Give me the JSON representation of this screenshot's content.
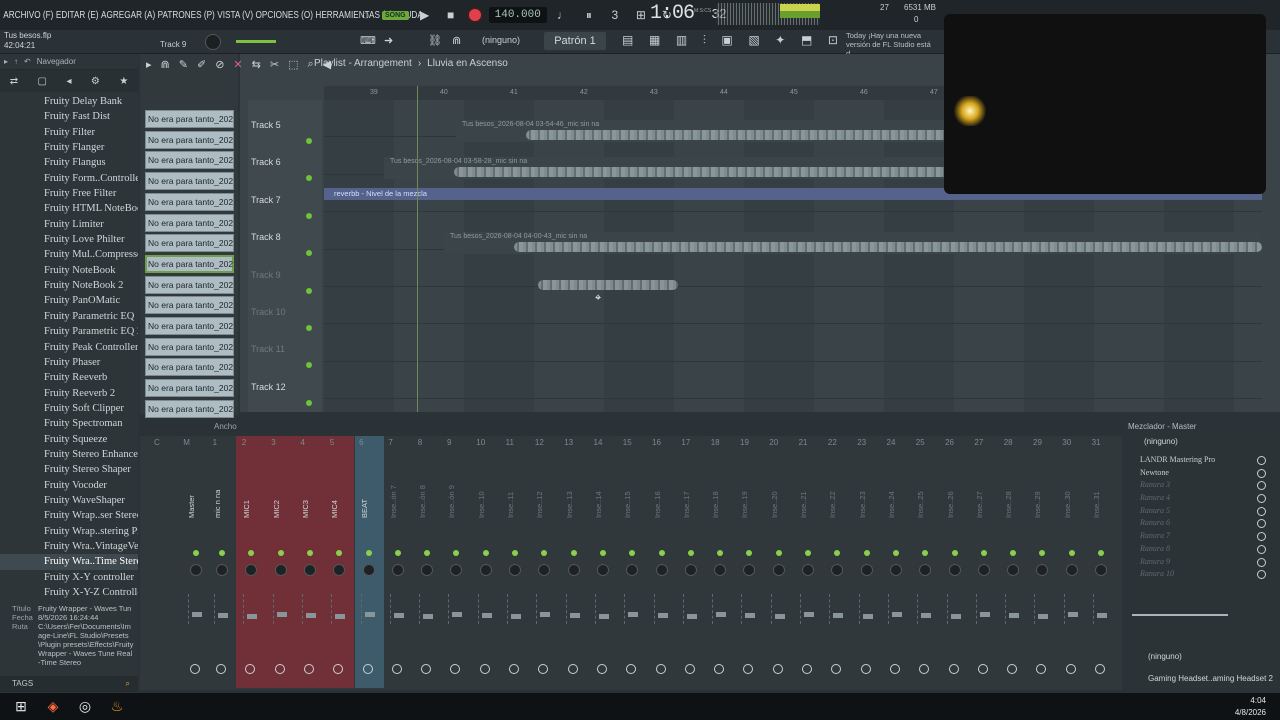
{
  "menu": {
    "items": [
      "ARCHIVO (F)",
      "EDITAR (E)",
      "AGREGAR (A)",
      "PATRONES (P)",
      "VISTA (V)",
      "OPCIONES (O)",
      "HERRAMIENTAS (T)",
      "AYUDA"
    ]
  },
  "transport": {
    "song_badge": "SONG",
    "tempo": "140.000",
    "time": "1:06",
    "time_sub": "32",
    "time_units": "M:S:CS"
  },
  "status": {
    "cpu": "27",
    "ram": "6531 MB",
    "voices": "0"
  },
  "song": {
    "name": "Tus besos.flp",
    "duration": "42:04:21",
    "current_track": "Track 9"
  },
  "toolbar": {
    "snap": "(ninguno)",
    "pattern": "Patrón 1",
    "news": "Today ¡Hay una nueva versión de FL Studio está d..."
  },
  "browser": {
    "title": "Navegador",
    "plugins": [
      "Fruity Delay Bank",
      "Fruity Fast Dist",
      "Fruity Filter",
      "Fruity Flanger",
      "Fruity Flangus",
      "Fruity Form..Controller",
      "Fruity Free Filter",
      "Fruity HTML NoteBook",
      "Fruity Limiter",
      "Fruity Love Philter",
      "Fruity Mul..Compressor",
      "Fruity NoteBook",
      "Fruity NoteBook 2",
      "Fruity PanOMatic",
      "Fruity Parametric EQ",
      "Fruity Parametric EQ 2",
      "Fruity Peak Controller",
      "Fruity Phaser",
      "Fruity Reeverb",
      "Fruity Reeverb 2",
      "Fruity Soft Clipper",
      "Fruity Spectroman",
      "Fruity Squeeze",
      "Fruity Stereo Enhancer",
      "Fruity Stereo Shaper",
      "Fruity Vocoder",
      "Fruity WaveShaper",
      "Fruity Wrap..ser Stereo",
      "Fruity Wrap..stering Pro",
      "Fruity Wra..VintageVerb",
      "Fruity Wra..Time Stereo",
      "Fruity X-Y controller",
      "Fruity X-Y-Z Controller"
    ],
    "selected_index": 30,
    "info": {
      "title_k": "Título",
      "title_v": "Fruity Wrapper - Waves Tun",
      "date_k": "Fecha",
      "date_v": "8/5/2026 16:24:44",
      "path_k": "Ruta",
      "path_v": "C:\\Users\\Fer\\Documents\\Image-Line\\FL Studio\\Presets\\Plugin presets\\Effects\\Fruity Wrapper - Waves Tune Real-Time Stereo"
    },
    "tags_label": "TAGS"
  },
  "picker": {
    "clip_label": "No era para tanto_2026-",
    "count": 15,
    "selected_index": 7
  },
  "playlist": {
    "title": "Playlist - Arrangement",
    "arrow": "›",
    "subtitle": "Lluvia en Ascenso",
    "ruler": [
      "39",
      "40",
      "41",
      "42",
      "43",
      "44",
      "45",
      "46",
      "47"
    ],
    "tracks": [
      {
        "name": "Track 5",
        "clip": "Tus besos_2026-08-04 03-54-46_mic sin na"
      },
      {
        "name": "Track 6",
        "clip": "Tus besos_2026-08-04 03-58-28_mic sin na"
      },
      {
        "name": "Track 7",
        "clip": "reverbb - Nivel de la mezcla"
      },
      {
        "name": "Track 8",
        "clip": "Tus besos_2026-08-04 04-00-43_mic sin na"
      },
      {
        "name": "Track 9",
        "clip": ""
      },
      {
        "name": "Track 10",
        "clip": ""
      },
      {
        "name": "Track 11",
        "clip": ""
      },
      {
        "name": "Track 12",
        "clip": ""
      }
    ]
  },
  "mixer": {
    "width_label": "Ancho",
    "master_label": "M",
    "strips": [
      "Master",
      "mic n na",
      "MIC1",
      "MIC2",
      "MIC3",
      "MIC4",
      "BEAT",
      "Inse..ón 7",
      "Inse..ón 8",
      "Inse..ón 9",
      "Inse..10",
      "Inse..11",
      "Inse..12",
      "Inse..13",
      "Inse..14",
      "Inse..15",
      "Inse..16",
      "Inse..17",
      "Inse..18",
      "Inse..19",
      "Inse..20",
      "Inse..21",
      "Inse..22",
      "Inse..23",
      "Inse..24",
      "Inse..25",
      "Inse..26",
      "Inse..27",
      "Inse..28",
      "Inse..29",
      "Inse..30",
      "Inse..31"
    ],
    "numbers": [
      "C",
      "M",
      "1",
      "2",
      "3",
      "4",
      "5",
      "6",
      "7",
      "8",
      "9",
      "10",
      "11",
      "12",
      "13",
      "14",
      "15",
      "16",
      "17",
      "18",
      "19",
      "20",
      "21",
      "22",
      "23",
      "24",
      "25",
      "26",
      "27",
      "28",
      "29",
      "30",
      "31"
    ]
  },
  "mixer_panel": {
    "title": "Mezclador - Master",
    "preset": "(ninguno)",
    "slots": [
      "LANDR Mastering Pro",
      "Newtone",
      "Ranura 3",
      "Ranura 4",
      "Ranura 5",
      "Ranura 6",
      "Ranura 7",
      "Ranura 8",
      "Ranura 9",
      "Ranura 10"
    ],
    "active_slots": 2,
    "eq_preset": "(ninguno)",
    "output": "Gaming Headset..aming Headset 2"
  },
  "taskbar": {
    "time": "4:04",
    "date": "4/8/2026"
  }
}
